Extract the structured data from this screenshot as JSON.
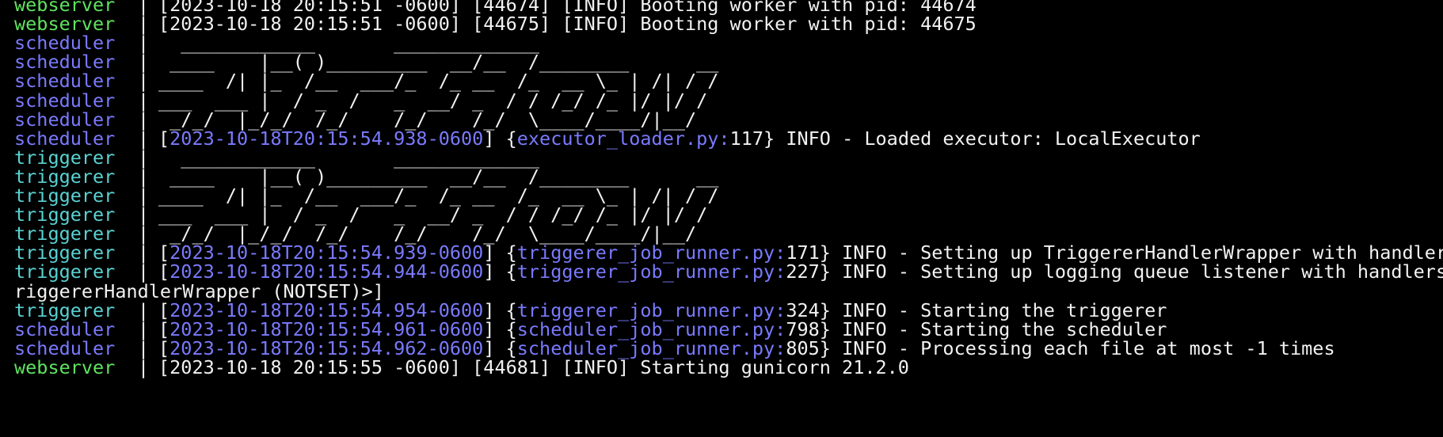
{
  "colors": {
    "background": "#000000",
    "text": "#f2f2f2",
    "webserver": "#5fe35f",
    "scheduler": "#7a7aff",
    "triggerer": "#5ad2d2",
    "timestamp": "#7a7aff",
    "module": "#7a7aff"
  },
  "separator": "|",
  "lines": [
    {
      "kind": "raw",
      "service": "webserver",
      "message": "[2023-10-18 20:15:51 -0600] [44674] [INFO] Booting worker with pid: 44674"
    },
    {
      "kind": "raw",
      "service": "webserver",
      "message": "[2023-10-18 20:15:51 -0600] [44675] [INFO] Booting worker with pid: 44675"
    },
    {
      "kind": "raw",
      "service": "scheduler",
      "message": "  ____________       _____________"
    },
    {
      "kind": "raw",
      "service": "scheduler",
      "message": " ____    |__( )_________  __/__  /________      __"
    },
    {
      "kind": "raw",
      "service": "scheduler",
      "message": "____  /| |_  /__  ___/_  /_ __  /_  __ \\_ | /| / /"
    },
    {
      "kind": "raw",
      "service": "scheduler",
      "message": "___  ___ |  / _  /   _  __/ _  / / /_/ /_ |/ |/ /"
    },
    {
      "kind": "raw",
      "service": "scheduler",
      "message": " _/_/  |_/_/  /_/    /_/    /_/  \\____/____/|__/"
    },
    {
      "kind": "log",
      "service": "scheduler",
      "ts": "2023-10-18T20:15:54.938-0600",
      "module": "executor_loader.py:",
      "lineno": "117",
      "message": " INFO - Loaded executor: LocalExecutor"
    },
    {
      "kind": "raw",
      "service": "triggerer",
      "message": "  ____________       _____________"
    },
    {
      "kind": "raw",
      "service": "triggerer",
      "message": " ____    |__( )_________  __/__  /________      __"
    },
    {
      "kind": "raw",
      "service": "triggerer",
      "message": "____  /| |_  /__  ___/_  /_ __  /_  __ \\_ | /| / /"
    },
    {
      "kind": "raw",
      "service": "triggerer",
      "message": "___  ___ |  / _  /   _  __/ _  / / /_/ /_ |/ |/ /"
    },
    {
      "kind": "raw",
      "service": "triggerer",
      "message": " _/_/  |_/_/  /_/    /_/    /_/  \\____/____/|__/"
    },
    {
      "kind": "log",
      "service": "triggerer",
      "ts": "2023-10-18T20:15:54.939-0600",
      "module": "triggerer_job_runner.py:",
      "lineno": "171",
      "message": " INFO - Setting up TriggererHandlerWrapper with handler"
    },
    {
      "kind": "log",
      "service": "triggerer",
      "ts": "2023-10-18T20:15:54.944-0600",
      "module": "triggerer_job_runner.py:",
      "lineno": "227",
      "message": " INFO - Setting up logging queue listener with handlers"
    },
    {
      "kind": "wrap",
      "message": "riggererHandlerWrapper (NOTSET)>]"
    },
    {
      "kind": "log",
      "service": "triggerer",
      "ts": "2023-10-18T20:15:54.954-0600",
      "module": "triggerer_job_runner.py:",
      "lineno": "324",
      "message": " INFO - Starting the triggerer"
    },
    {
      "kind": "log",
      "service": "scheduler",
      "ts": "2023-10-18T20:15:54.961-0600",
      "module": "scheduler_job_runner.py:",
      "lineno": "798",
      "message": " INFO - Starting the scheduler"
    },
    {
      "kind": "log",
      "service": "scheduler",
      "ts": "2023-10-18T20:15:54.962-0600",
      "module": "scheduler_job_runner.py:",
      "lineno": "805",
      "message": " INFO - Processing each file at most -1 times"
    },
    {
      "kind": "raw",
      "service": "webserver",
      "message": "[2023-10-18 20:15:55 -0600] [44681] [INFO] Starting gunicorn 21.2.0"
    }
  ]
}
